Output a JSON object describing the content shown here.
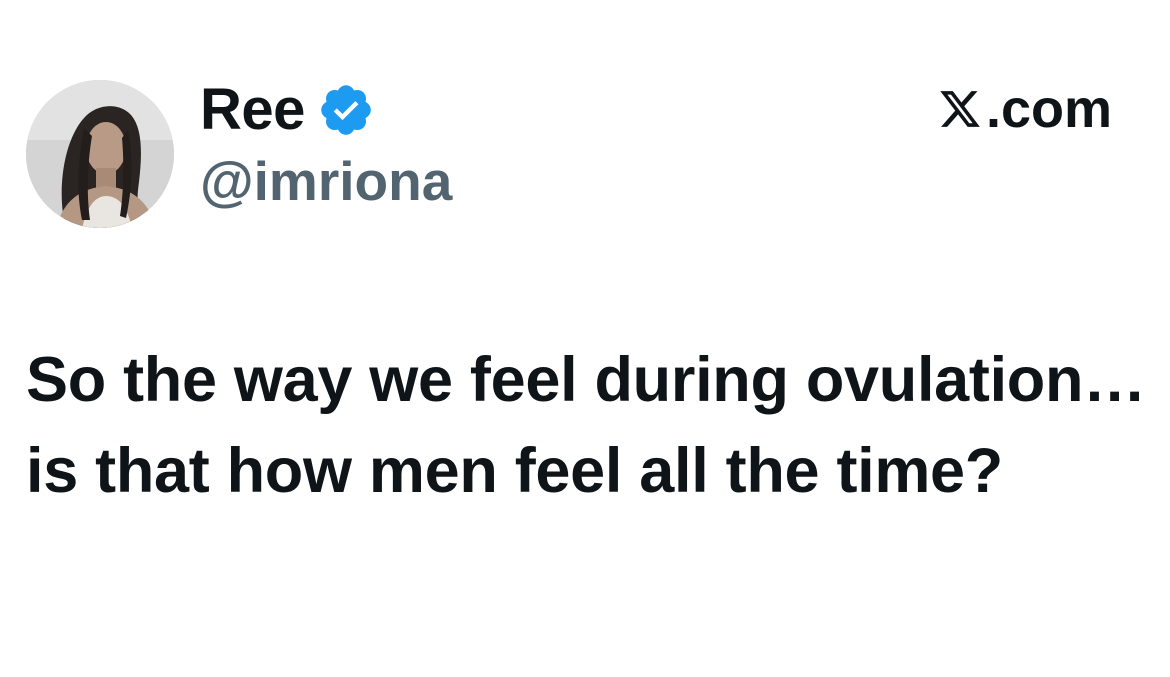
{
  "author": {
    "display_name": "Ree",
    "handle": "@imriona",
    "verified": true,
    "avatar_icon": "profile-photo",
    "verified_icon": "verified-badge-icon"
  },
  "brand": {
    "label": ".com",
    "logo_icon": "x-logo-icon"
  },
  "tweet": {
    "text": "So the way we feel during ovulation… is that how men feel all the time?"
  },
  "colors": {
    "text_primary": "#0f1419",
    "text_secondary": "#536471",
    "verified_blue": "#1d9bf0",
    "background": "#ffffff"
  }
}
